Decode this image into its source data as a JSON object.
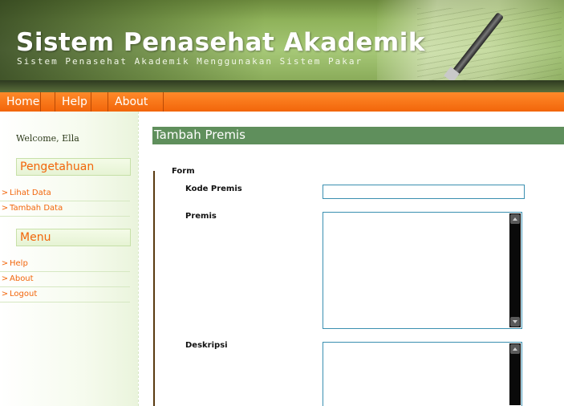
{
  "header": {
    "title": "Sistem Penasehat Akademik",
    "subtitle": "Sistem Penasehat Akademik Menggunakan Sistem Pakar"
  },
  "nav": {
    "items": [
      {
        "label": "Home"
      },
      {
        "label": "Help"
      },
      {
        "label": "About"
      }
    ]
  },
  "sidebar": {
    "welcome": "Welcome, Ella",
    "pengetahuan": {
      "heading": "Pengetahuan",
      "links": [
        {
          "label": "Lihat Data"
        },
        {
          "label": "Tambah Data"
        }
      ]
    },
    "menu": {
      "heading": "Menu",
      "links": [
        {
          "label": "Help"
        },
        {
          "label": "About"
        },
        {
          "label": "Logout"
        }
      ]
    },
    "chevron": ">"
  },
  "main": {
    "title": "Tambah Premis",
    "form": {
      "legend": "Form",
      "kode_label": "Kode Premis",
      "kode_value": "",
      "premis_label": "Premis",
      "premis_value": "",
      "deskripsi_label": "Deskripsi",
      "deskripsi_value": ""
    }
  },
  "colors": {
    "accent": "#f2650a",
    "title_bar": "#5f8f5c",
    "input_border": "#3a8fb0"
  }
}
